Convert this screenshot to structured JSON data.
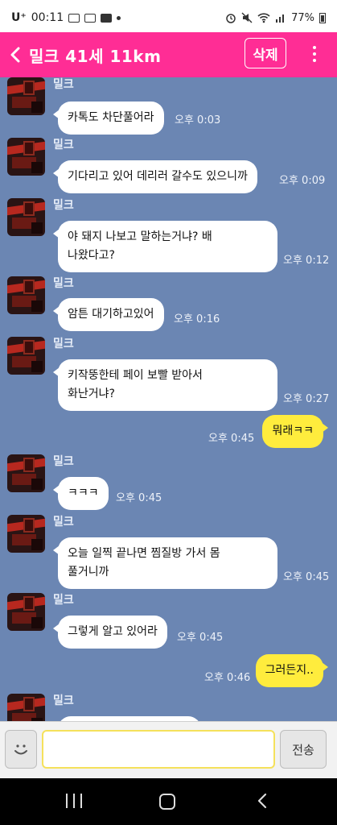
{
  "status_bar": {
    "carrier": "U⁺",
    "time": "00:11",
    "battery": "77%"
  },
  "header": {
    "title": "밀크 41세 11km",
    "delete_label": "삭제"
  },
  "messages": [
    {
      "sender": "밀크",
      "lines": [
        "카톡도 차단풀어라"
      ],
      "time": "오후 0:03"
    },
    {
      "sender": "밀크",
      "lines": [
        "기다리고 있어 데리러 갈수도 있으니까"
      ],
      "time": "오후 0:09"
    },
    {
      "sender": "밀크",
      "lines": [
        "야 돼지 나보고 말하는거냐? 배",
        "나왔다고?"
      ],
      "time": "오후 0:12"
    },
    {
      "sender": "밀크",
      "lines": [
        "암튼 대기하고있어"
      ],
      "time": "오후 0:16"
    },
    {
      "sender": "밀크",
      "lines": [
        "키작뚱한테 페이 보빨 받아서",
        "화난거냐?"
      ],
      "time": "오후 0:27"
    },
    {
      "sender": "",
      "lines": [
        "뭐래ㅋㅋ"
      ],
      "time": "오후 0:45",
      "outgoing": true
    },
    {
      "sender": "밀크",
      "lines": [
        "ㅋㅋㅋ"
      ],
      "time": "오후 0:45"
    },
    {
      "sender": "밀크",
      "lines": [
        "오늘 일찍 끝나면 찜질방 가서 몸",
        "풀거니까"
      ],
      "time": "오후 0:45"
    },
    {
      "sender": "밀크",
      "lines": [
        "그렇게 알고 있어라"
      ],
      "time": "오후 0:45"
    },
    {
      "sender": "",
      "lines": [
        "그러든지.."
      ],
      "time": "오후 0:46",
      "outgoing": true
    },
    {
      "sender": "밀크",
      "lines": [
        ""
      ],
      "time": ""
    }
  ],
  "input": {
    "value": "",
    "send_label": "전송"
  },
  "colors": {
    "header": "#ff2d95",
    "chat_background": "#6b86b3",
    "outgoing_bubble": "#ffec3d",
    "incoming_bubble": "#ffffff"
  },
  "icons": {
    "back": "chevron-left-icon",
    "menu": "more-vertical-icon",
    "emoji": "smiley-icon"
  }
}
